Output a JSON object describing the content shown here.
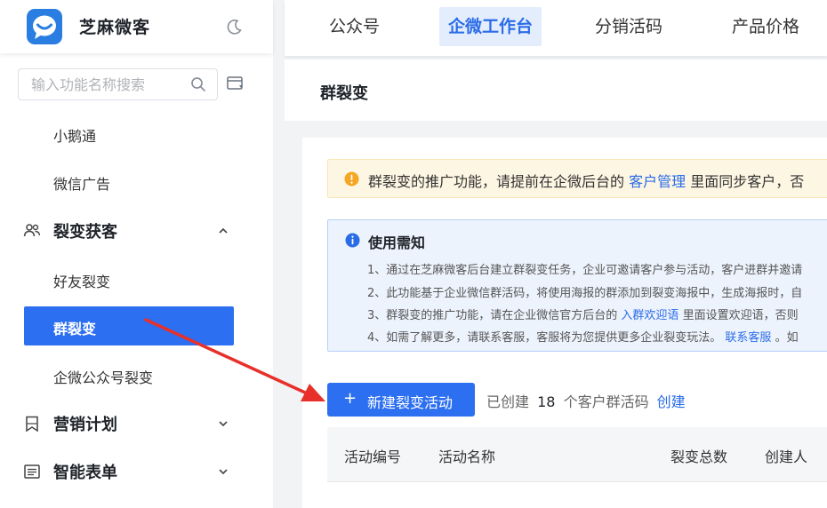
{
  "brand": {
    "name": "芝麻微客"
  },
  "search": {
    "placeholder": "输入功能名称搜索"
  },
  "menu": {
    "items": [
      {
        "label": "小鹅通"
      },
      {
        "label": "微信广告"
      },
      {
        "label": "裂变获客"
      },
      {
        "label": "好友裂变"
      },
      {
        "label": "群裂变"
      },
      {
        "label": "企微公众号裂变"
      },
      {
        "label": "营销计划"
      },
      {
        "label": "智能表单"
      }
    ]
  },
  "topnav": {
    "tabs": [
      {
        "label": "公众号"
      },
      {
        "label": "企微工作台"
      },
      {
        "label": "分销活码"
      },
      {
        "label": "产品价格"
      }
    ]
  },
  "page": {
    "title": "群裂变"
  },
  "warning": {
    "text_before": "群裂变的推广功能，请提前在企微后台的",
    "link": "客户管理",
    "text_after": "里面同步客户，否"
  },
  "notice": {
    "title": "使用需知",
    "line1": "1、通过在芝麻微客后台建立群裂变任务，企业可邀请客户参与活动，客户进群并邀请",
    "line2": "2、此功能基于企业微信群活码，将使用海报的群添加到裂变海报中，生成海报时，自",
    "line3_before": "3、群裂变的推广功能，请在企业微信官方后台的",
    "line3_link": "入群欢迎语",
    "line3_after": "里面设置欢迎语，否则",
    "line4_before": "4、如需了解更多，请联系客服，客服将为您提供更多企业裂变玩法。",
    "line4_link": "联系客服",
    "line4_after": "。如"
  },
  "actions": {
    "create_label": "新建裂变活动",
    "created_prefix": "已创建",
    "created_count": "18",
    "created_suffix": "个客户群活码",
    "create_link": "创建"
  },
  "table": {
    "columns": [
      "活动编号",
      "活动名称",
      "裂变总数",
      "创建人"
    ]
  },
  "colors": {
    "primary": "#2c6ff0",
    "link": "#2a6ce8",
    "warning_bg": "#fdf6e3",
    "notice_bg": "#edf3fd",
    "arrow": "#e8302a"
  }
}
